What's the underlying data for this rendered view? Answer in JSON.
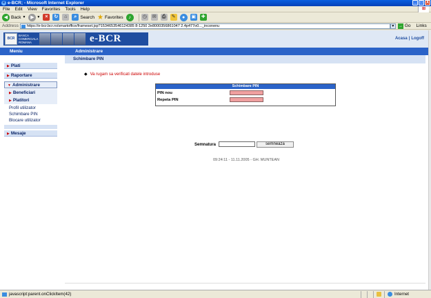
{
  "window": {
    "title": "e-BCR; - Microsoft Internet Explorer",
    "minimize": "_",
    "maximize": "□",
    "close": "X"
  },
  "menubar": [
    "File",
    "Edit",
    "View",
    "Favorites",
    "Tools",
    "Help"
  ],
  "toolbar": {
    "back_label": "Back",
    "search_label": "Search",
    "favorites_label": "Favorites"
  },
  "addressbar": {
    "label": "Address",
    "url": "https://e-bcr.bcr.ro/smartoffice/frameset.jsp?1534653546124385 8-1250 2e8000356861047 2.4p477o0..._inconenu",
    "go_label": "Go",
    "links_label": "Links"
  },
  "header": {
    "bank_name": "BANCA COMERCIALA ROMANA",
    "brand": "e-BCR",
    "links": [
      "Acasa",
      "Logoff"
    ],
    "nav": [
      "Meniu",
      "Administrare"
    ]
  },
  "sidebar": {
    "items": [
      "Plati",
      "Raportare",
      "Administrare",
      "Mesaje"
    ],
    "sub_items": [
      "Beneficiari",
      "Platitori"
    ],
    "leaf_items": [
      "Profil utilizator",
      "Schimbare PIN",
      "Blocare utilizator"
    ]
  },
  "content": {
    "breadcrumb": "Schimbare PIN",
    "alert": "Va rugam sa verificati datele introduse",
    "form_title": "Schimbare PIN",
    "pin_new_label": "PIN nou",
    "pin_repeat_label": "Repeta PIN",
    "signature_label": "Semnatura",
    "sign_button": "semneaza",
    "footer_info": "09:24:11 - 11.11.2005 - GH. MUNTEAN"
  },
  "statusbar": {
    "text": "javascript:parent.onClickItem(42)",
    "zone": "Internet"
  }
}
